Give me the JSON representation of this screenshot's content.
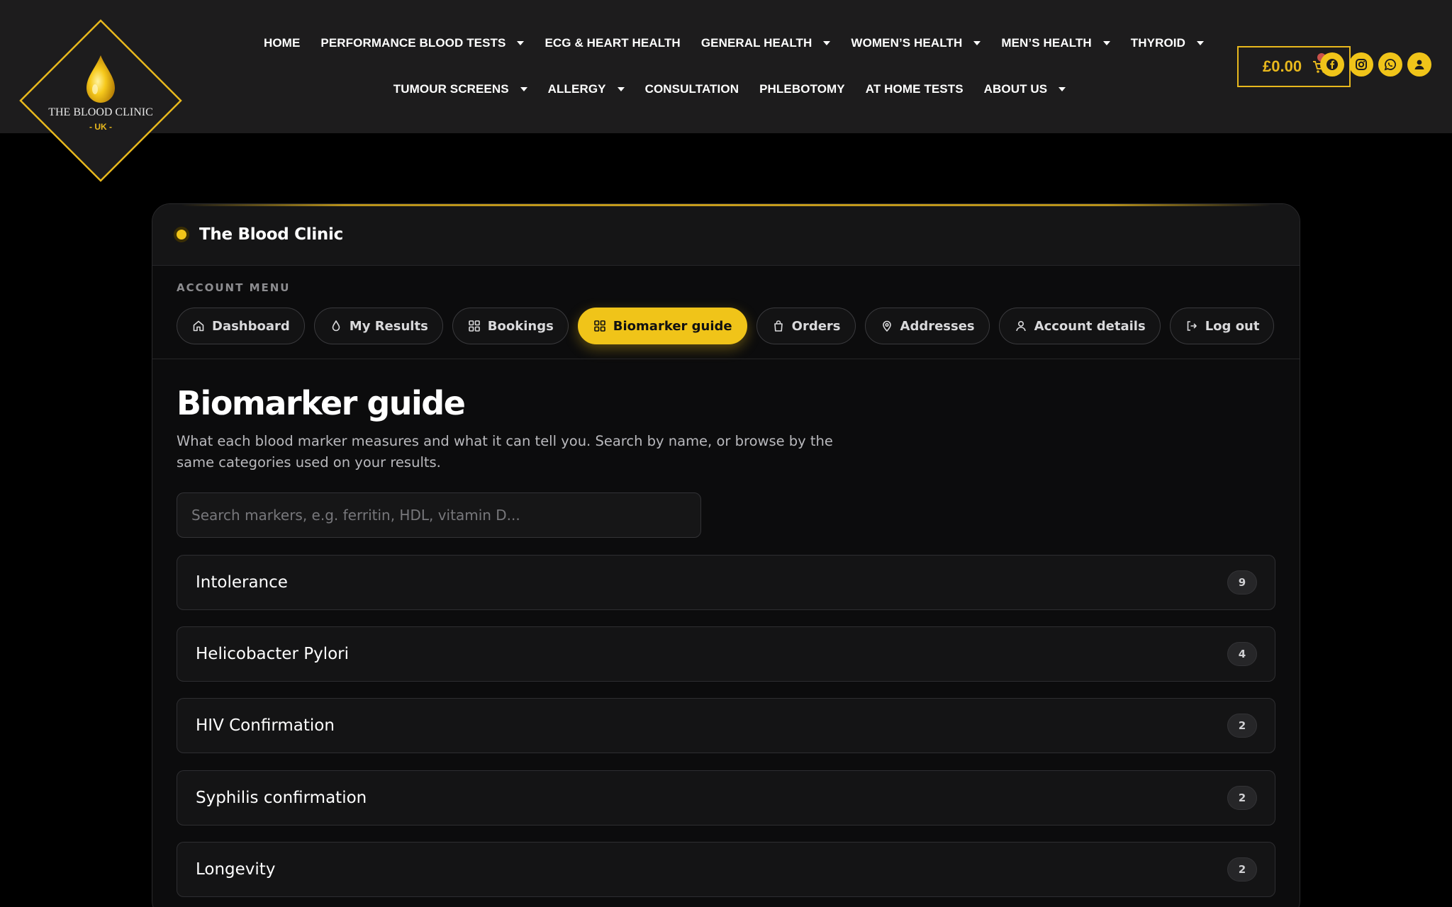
{
  "logo": {
    "name": "THE BLOOD CLINIC",
    "region": "- UK -"
  },
  "nav": {
    "row1": [
      {
        "label": "HOME",
        "dropdown": false
      },
      {
        "label": "PERFORMANCE BLOOD TESTS",
        "dropdown": true
      },
      {
        "label": "ECG & HEART HEALTH",
        "dropdown": false
      },
      {
        "label": "GENERAL HEALTH",
        "dropdown": true
      },
      {
        "label": "WOMEN’S HEALTH",
        "dropdown": true
      },
      {
        "label": "MEN’S HEALTH",
        "dropdown": true
      },
      {
        "label": "THYROID",
        "dropdown": true
      }
    ],
    "row2": [
      {
        "label": "TUMOUR SCREENS",
        "dropdown": true
      },
      {
        "label": "ALLERGY",
        "dropdown": true
      },
      {
        "label": "CONSULTATION",
        "dropdown": false
      },
      {
        "label": "PHLEBOTOMY",
        "dropdown": false
      },
      {
        "label": "AT HOME TESTS",
        "dropdown": false
      },
      {
        "label": "ABOUT US",
        "dropdown": true
      }
    ]
  },
  "cart": {
    "amount": "£0.00"
  },
  "social_icons": [
    "facebook-icon",
    "instagram-icon",
    "whatsapp-icon",
    "user-icon"
  ],
  "colors": {
    "accent": "#f0c419",
    "header_bg": "#1d1c1d",
    "page_bg": "#000000",
    "panel_bg": "#0c0c0d"
  },
  "panel": {
    "brand": "The Blood Clinic",
    "menu_label": "ACCOUNT MENU",
    "tabs": [
      {
        "label": "Dashboard",
        "icon": "home-icon",
        "active": false
      },
      {
        "label": "My Results",
        "icon": "droplet-icon",
        "active": false
      },
      {
        "label": "Bookings",
        "icon": "grid-icon",
        "active": false
      },
      {
        "label": "Biomarker guide",
        "icon": "grid-icon",
        "active": true
      },
      {
        "label": "Orders",
        "icon": "bag-icon",
        "active": false
      },
      {
        "label": "Addresses",
        "icon": "map-pin-icon",
        "active": false
      },
      {
        "label": "Account details",
        "icon": "user-icon",
        "active": false
      },
      {
        "label": "Log out",
        "icon": "logout-icon",
        "active": false
      }
    ]
  },
  "main": {
    "title": "Biomarker guide",
    "intro": "What each blood marker measures and what it can tell you. Search by name, or browse by the same categories used on your results.",
    "search_placeholder": "Search markers, e.g. ferritin, HDL, vitamin D...",
    "categories": [
      {
        "name": "Intolerance",
        "count": "9"
      },
      {
        "name": "Helicobacter Pylori",
        "count": "4"
      },
      {
        "name": "HIV Confirmation",
        "count": "2"
      },
      {
        "name": "Syphilis confirmation",
        "count": "2"
      },
      {
        "name": "Longevity",
        "count": "2"
      }
    ]
  }
}
